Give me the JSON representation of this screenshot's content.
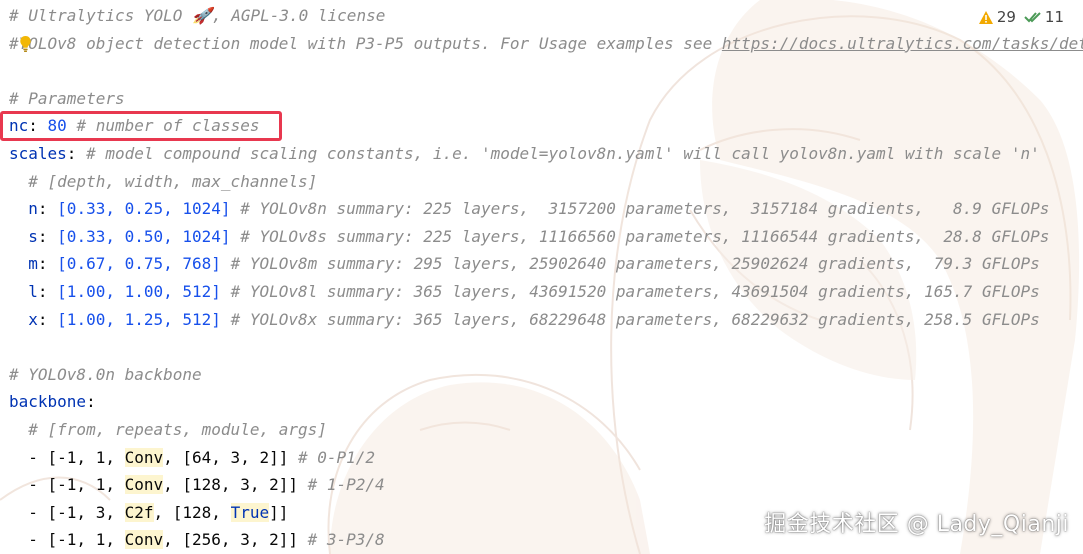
{
  "colors": {
    "comment": "#8c8c8c",
    "keyword": "#0033b3",
    "number": "#1750eb",
    "highlight_box": "#e8384f",
    "warning": "#f2a900",
    "ok_check": "#4c9a57"
  },
  "inspection": {
    "warning_icon": "warning-triangle-icon",
    "warnings": "29",
    "check_icon": "double-check-icon",
    "weak_warnings": "11"
  },
  "code": {
    "l1_comment": "# Ultralytics YOLO 🚀, AGPL-3.0 license",
    "l2_comment_a": "#",
    "l2_comment_b": "YOLOv8 object detection model with P3-P5 outputs. For Usage examples see ",
    "l2_url": "https://docs.ultralytics.com/tasks/detect",
    "l4_comment": "# Parameters",
    "nc_key": "nc",
    "nc_value": "80",
    "nc_comment": "# number of classes",
    "scales_key": "scales",
    "scales_comment": "# model compound scaling constants, i.e. 'model=yolov8n.yaml' will call yolov8n.yaml with scale 'n'",
    "scales_sub_comment": "# [depth, width, max_channels]",
    "scale_rows": [
      {
        "key": "n",
        "vals": "[0.33, 0.25, 1024]",
        "comment": "# YOLOv8n summary: 225 layers,  3157200 parameters,  3157184 gradients,   8.9 GFLOPs"
      },
      {
        "key": "s",
        "vals": "[0.33, 0.50, 1024]",
        "comment": "# YOLOv8s summary: 225 layers, 11166560 parameters, 11166544 gradients,  28.8 GFLOPs"
      },
      {
        "key": "m",
        "vals": "[0.67, 0.75, 768]",
        "comment": "# YOLOv8m summary: 295 layers, 25902640 parameters, 25902624 gradients,  79.3 GFLOPs"
      },
      {
        "key": "l",
        "vals": "[1.00, 1.00, 512]",
        "comment": "# YOLOv8l summary: 365 layers, 43691520 parameters, 43691504 gradients, 165.7 GFLOPs"
      },
      {
        "key": "x",
        "vals": "[1.00, 1.25, 512]",
        "comment": "# YOLOv8x summary: 365 layers, 68229648 parameters, 68229632 gradients, 258.5 GFLOPs"
      }
    ],
    "backbone_comment": "# YOLOv8.0n backbone",
    "backbone_key": "backbone",
    "backbone_sub_comment": "# [from, repeats, module, args]",
    "backbone_rows": [
      {
        "pre": "- [-1, 1, ",
        "module": "Conv",
        "mid": ", [64, 3, 2]]",
        "arg": "",
        "post": "",
        "comment": "# 0-P1/2"
      },
      {
        "pre": "- [-1, 1, ",
        "module": "Conv",
        "mid": ", [128, 3, 2]]",
        "arg": "",
        "post": "",
        "comment": "# 1-P2/4"
      },
      {
        "pre": "- [-1, 3, ",
        "module": "C2f",
        "mid": ", [128, ",
        "arg": "True",
        "post": "]]",
        "comment": ""
      },
      {
        "pre": "- [-1, 1, ",
        "module": "Conv",
        "mid": ", [256, 3, 2]]",
        "arg": "",
        "post": "",
        "comment": "# 3-P3/8"
      }
    ]
  },
  "watermark": "掘金技术社区 @ Lady_Qianji"
}
